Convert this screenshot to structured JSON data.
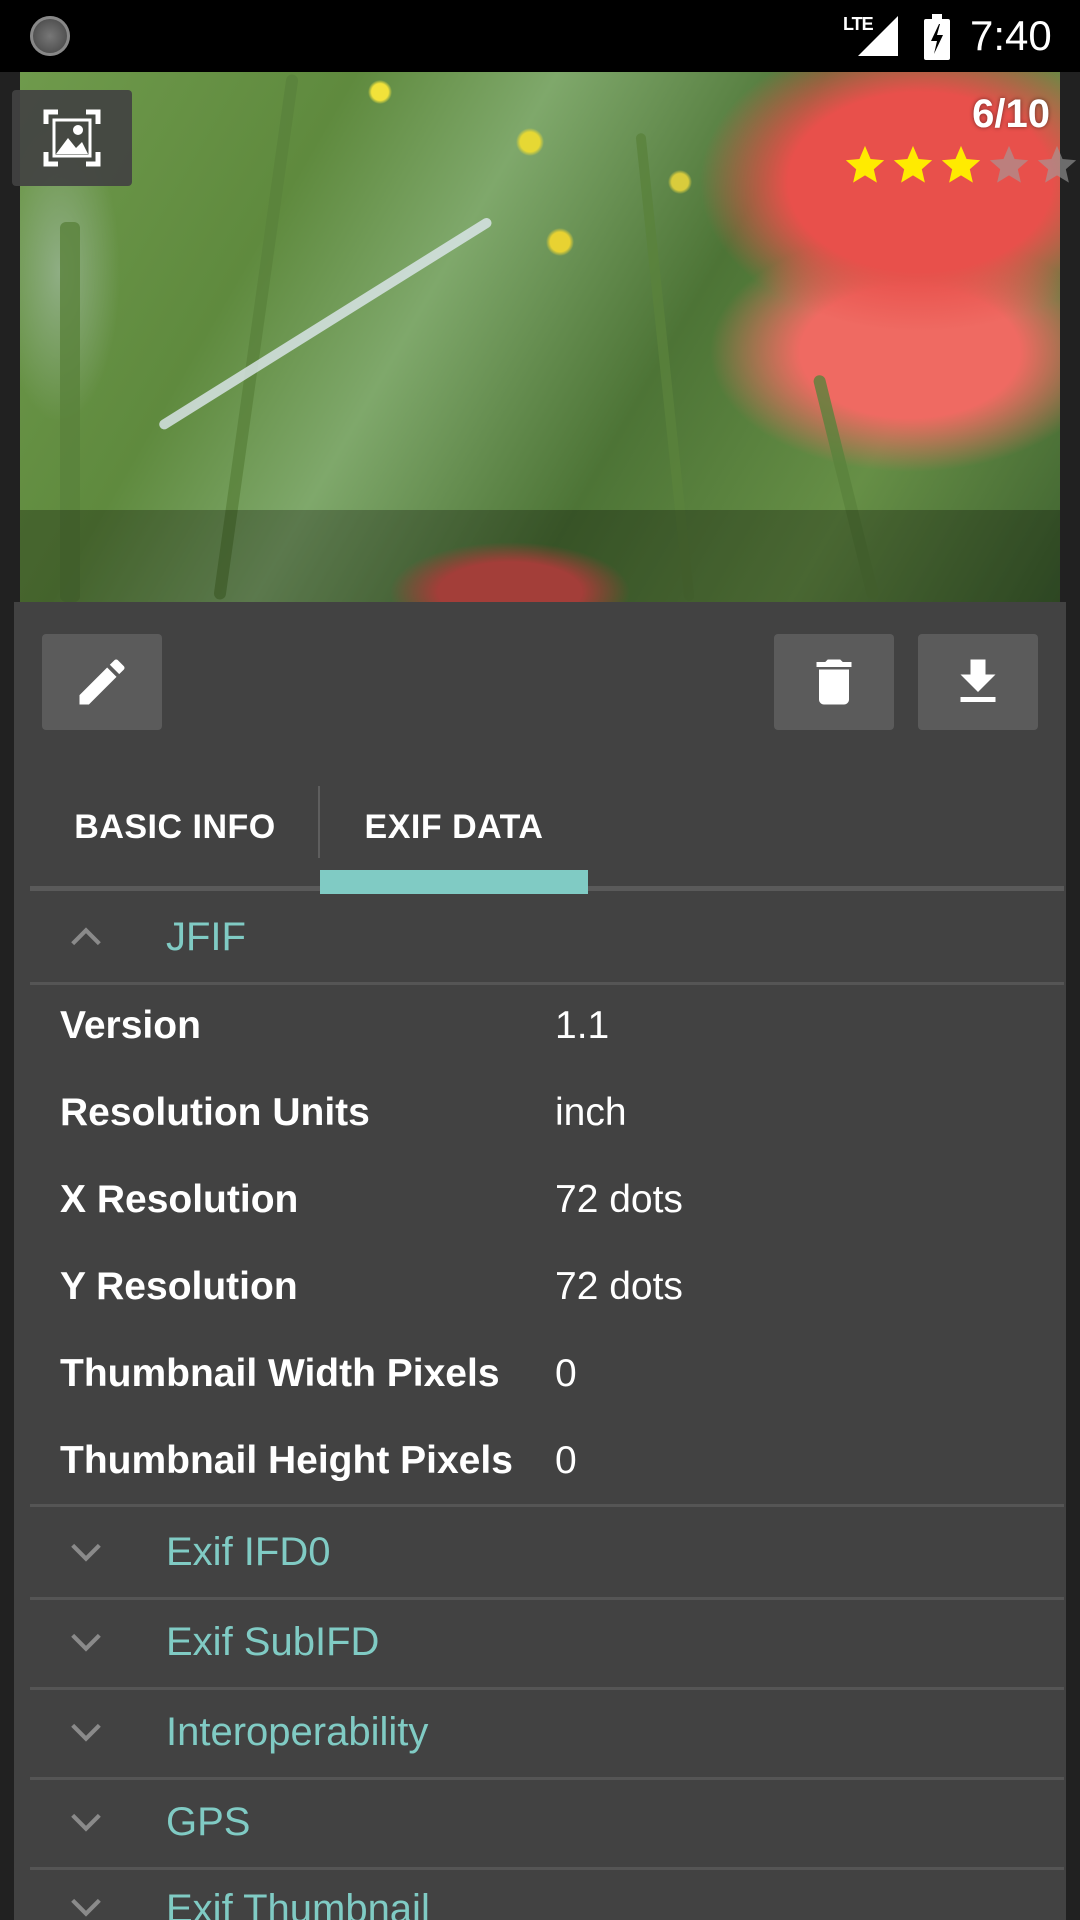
{
  "status_bar": {
    "left_icon": "loading-circle-icon",
    "network": "LTE",
    "time": "7:40"
  },
  "photo": {
    "rating_text": "6/10",
    "stars_filled": 3,
    "stars_total": 5,
    "view_full_icon": "fullscreen-image-icon"
  },
  "toolbar": {
    "edit_icon": "pencil-icon",
    "delete_icon": "trash-icon",
    "download_icon": "download-icon"
  },
  "tabs": [
    {
      "label": "BASIC INFO"
    },
    {
      "label": "EXIF DATA"
    }
  ],
  "sections": [
    {
      "title": "JFIF",
      "expanded": true,
      "rows": [
        {
          "key": "Version",
          "value": "1.1"
        },
        {
          "key": "Resolution Units",
          "value": "inch"
        },
        {
          "key": "X Resolution",
          "value": "72 dots"
        },
        {
          "key": "Y Resolution",
          "value": "72 dots"
        },
        {
          "key": "Thumbnail Width Pixels",
          "value": "0"
        },
        {
          "key": "Thumbnail Height Pixels",
          "value": "0"
        }
      ]
    },
    {
      "title": "Exif IFD0",
      "expanded": false
    },
    {
      "title": "Exif SubIFD",
      "expanded": false
    },
    {
      "title": "Interoperability",
      "expanded": false
    },
    {
      "title": "GPS",
      "expanded": false
    },
    {
      "title": "Exif Thumbnail",
      "expanded": false
    }
  ],
  "colors": {
    "accent": "#80cbc4",
    "panel": "#424242",
    "button": "#5b5b5b",
    "star_filled": "#ffeb00",
    "star_empty": "#9e9e9e"
  }
}
